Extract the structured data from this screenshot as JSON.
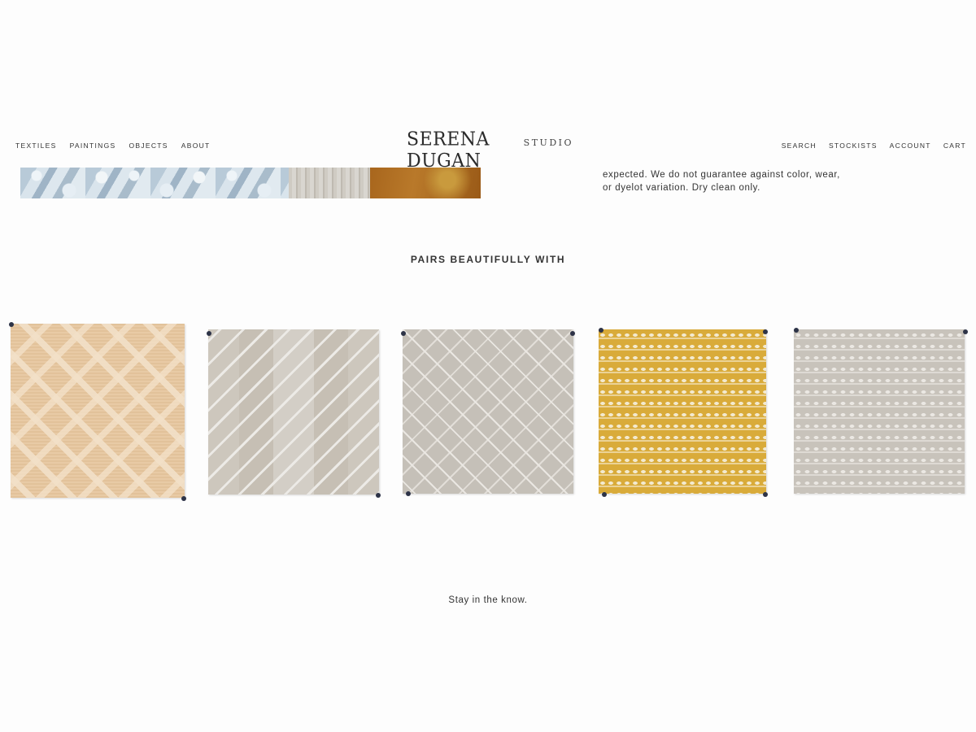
{
  "header": {
    "nav_left": [
      "TEXTILES",
      "PAINTINGS",
      "OBJECTS",
      "ABOUT"
    ],
    "logo_main": "SERENA DUGAN",
    "logo_sub": "STUDIO",
    "nav_right": [
      "SEARCH",
      "STOCKISTS",
      "ACCOUNT",
      "CART"
    ]
  },
  "product": {
    "care_text": "expected. We do not guarantee against color, wear, or dyelot variation. Dry clean only."
  },
  "pairs": {
    "title": "PAIRS BEAUTIFULLY WITH",
    "swatch_colors": [
      "#e4c49d",
      "#cdc7bd",
      "#c5c0b8",
      "#d9ab3a",
      "#c8c3bb"
    ]
  },
  "footer": {
    "newsletter_text": "Stay in the know."
  }
}
